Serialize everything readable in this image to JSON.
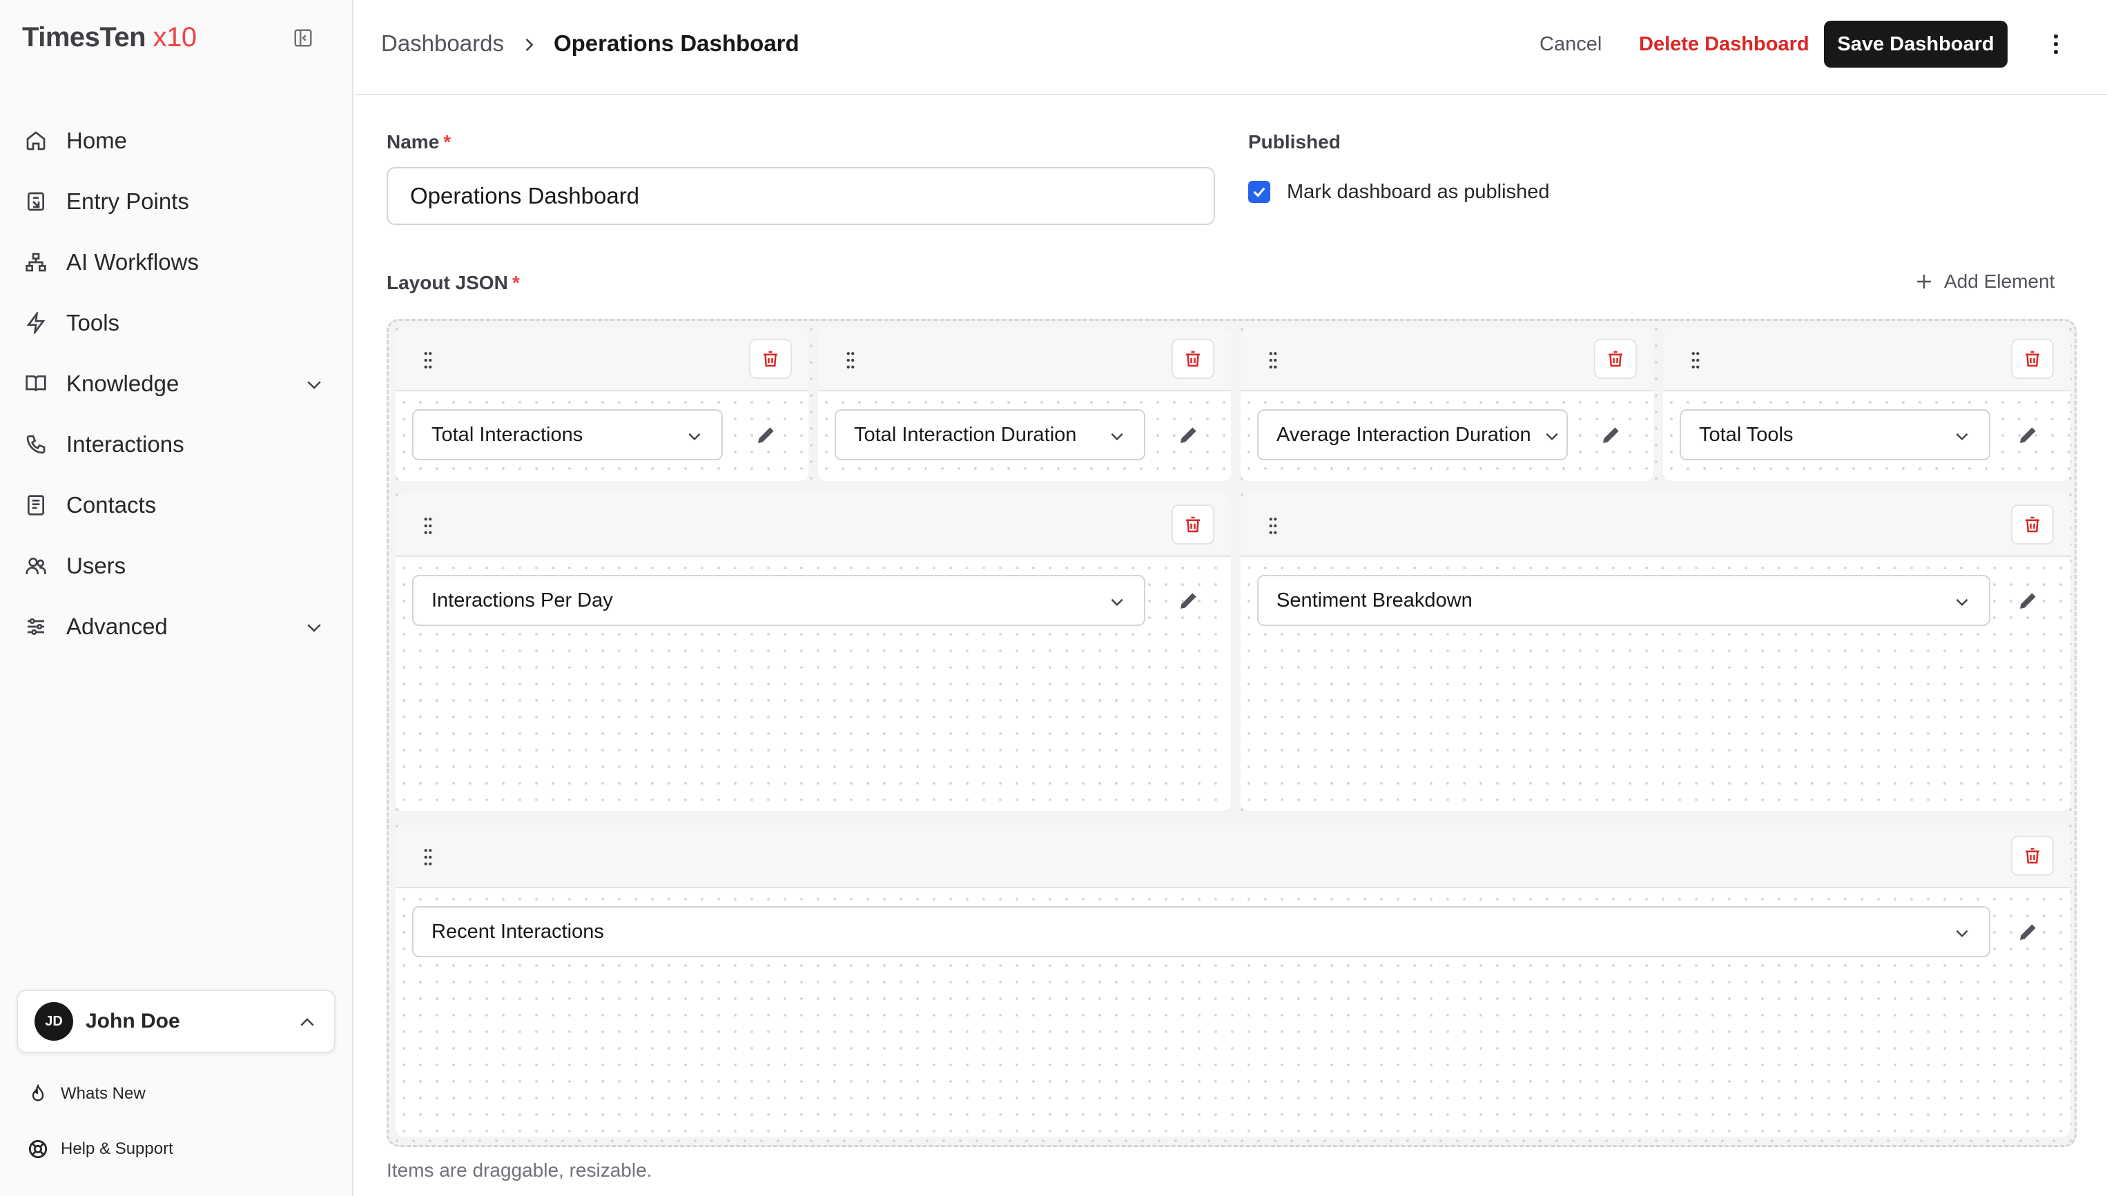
{
  "app": {
    "brand": "TimesTen",
    "brand_suffix": "x10"
  },
  "sidebar": {
    "items": [
      {
        "label": "Home",
        "icon": "home-icon"
      },
      {
        "label": "Entry Points",
        "icon": "entry-points-icon"
      },
      {
        "label": "AI Workflows",
        "icon": "workflow-icon"
      },
      {
        "label": "Tools",
        "icon": "bolt-icon"
      },
      {
        "label": "Knowledge",
        "icon": "book-icon",
        "expandable": true
      },
      {
        "label": "Interactions",
        "icon": "phone-icon"
      },
      {
        "label": "Contacts",
        "icon": "contacts-icon"
      },
      {
        "label": "Users",
        "icon": "users-icon"
      },
      {
        "label": "Advanced",
        "icon": "sliders-icon",
        "expandable": true
      }
    ],
    "user": {
      "initials": "JD",
      "name": "John Doe"
    },
    "footer": {
      "whats_new": "Whats New",
      "help": "Help & Support"
    }
  },
  "header": {
    "breadcrumb_parent": "Dashboards",
    "breadcrumb_current": "Operations Dashboard",
    "cancel": "Cancel",
    "delete": "Delete Dashboard",
    "save": "Save Dashboard"
  },
  "form": {
    "name_label": "Name",
    "required_mark": "*",
    "name_value": "Operations Dashboard",
    "published_label": "Published",
    "published_checkbox_label": "Mark dashboard as published",
    "published_checked": true,
    "layout_label": "Layout JSON",
    "add_element": "Add Element",
    "hint": "Items are draggable, resizable."
  },
  "widgets": [
    {
      "selected": "Total Interactions"
    },
    {
      "selected": "Total Interaction Duration"
    },
    {
      "selected": "Average Interaction Duration"
    },
    {
      "selected": "Total Tools"
    },
    {
      "selected": "Interactions Per Day"
    },
    {
      "selected": "Sentiment Breakdown"
    },
    {
      "selected": "Recent Interactions"
    }
  ],
  "colors": {
    "accent": "#2563eb",
    "danger": "#dc2626",
    "primary": "#18181b"
  }
}
